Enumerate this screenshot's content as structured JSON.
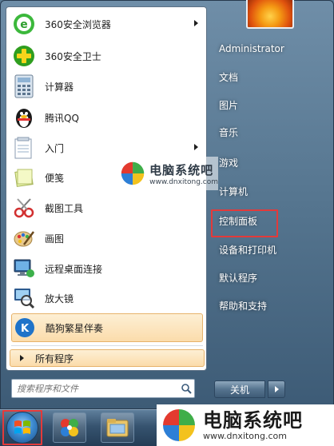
{
  "programs": [
    {
      "label": "360安全浏览器",
      "icon": "360-browser-icon",
      "has_arrow": true
    },
    {
      "label": "360安全卫士",
      "icon": "360-guard-icon",
      "has_arrow": false
    },
    {
      "label": "计算器",
      "icon": "calculator-icon",
      "has_arrow": false
    },
    {
      "label": "腾讯QQ",
      "icon": "qq-penguin-icon",
      "has_arrow": false
    },
    {
      "label": "入门",
      "icon": "getting-started-icon",
      "has_arrow": true
    },
    {
      "label": "便笺",
      "icon": "sticky-notes-icon",
      "has_arrow": false
    },
    {
      "label": "截图工具",
      "icon": "snipping-tool-icon",
      "has_arrow": false
    },
    {
      "label": "画图",
      "icon": "paint-icon",
      "has_arrow": false
    },
    {
      "label": "远程桌面连接",
      "icon": "remote-desktop-icon",
      "has_arrow": false
    },
    {
      "label": "放大镜",
      "icon": "magnifier-icon",
      "has_arrow": false
    },
    {
      "label": "酷狗繁星伴奏",
      "icon": "kugou-icon",
      "has_arrow": false
    }
  ],
  "all_programs_label": "所有程序",
  "search": {
    "placeholder": "搜索程序和文件"
  },
  "right_items": [
    {
      "label": "Administrator"
    },
    {
      "label": "文档"
    },
    {
      "label": "图片"
    },
    {
      "label": "音乐"
    },
    {
      "label": "游戏"
    },
    {
      "label": "计算机"
    },
    {
      "label": "控制面板"
    },
    {
      "label": "设备和打印机"
    },
    {
      "label": "默认程序"
    },
    {
      "label": "帮助和支持"
    }
  ],
  "shutdown_label": "关机",
  "watermark": {
    "title": "电脑系统吧",
    "url": "www.dnxitong.com"
  },
  "colors": {
    "highlight_border": "#e33a3a",
    "hover_fill": "#fbdcab"
  }
}
